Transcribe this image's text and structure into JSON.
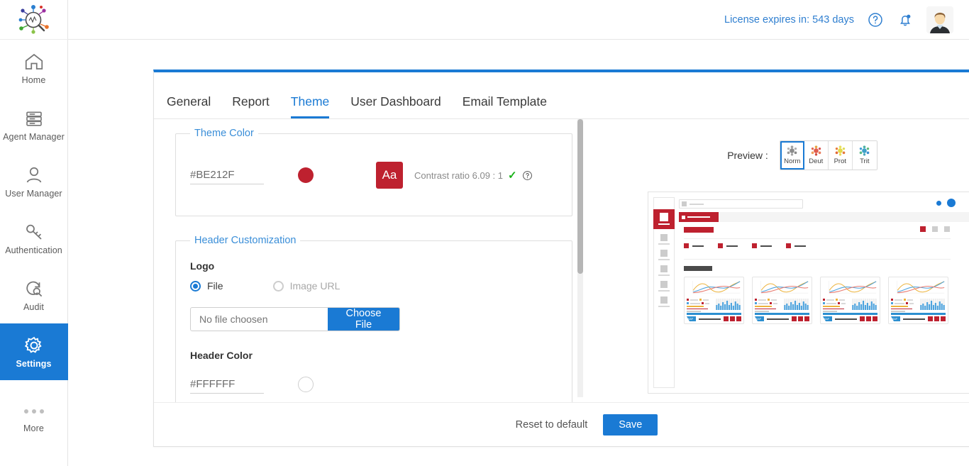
{
  "brand": {
    "logo_icon": "magnifier-analytics-logo",
    "accent_blue": "#1a7ad4"
  },
  "topbar": {
    "license_text": "License expires in: 543 days",
    "help_icon": "help-circle-icon",
    "notification_icon": "bell-icon",
    "avatar_icon": "user-avatar"
  },
  "sidebar": {
    "items": [
      {
        "label": "Home",
        "icon": "home-icon",
        "active": false
      },
      {
        "label": "Agent Manager",
        "icon": "server-icon",
        "active": false
      },
      {
        "label": "User Manager",
        "icon": "user-icon",
        "active": false
      },
      {
        "label": "Authentication",
        "icon": "key-icon",
        "active": false
      },
      {
        "label": "Audit",
        "icon": "audit-search-icon",
        "active": false
      },
      {
        "label": "Settings",
        "icon": "gear-icon",
        "active": true
      }
    ],
    "more_label": "More",
    "more_icon": "ellipsis-icon"
  },
  "tabs": [
    {
      "label": "General",
      "active": false
    },
    {
      "label": "Report",
      "active": false
    },
    {
      "label": "Theme",
      "active": true
    },
    {
      "label": "User Dashboard",
      "active": false
    },
    {
      "label": "Email Template",
      "active": false
    }
  ],
  "theme_color": {
    "legend": "Theme Color",
    "hex_value": "#BE212F",
    "swatch_color": "#BE212F",
    "sample_text": "Aa",
    "contrast_text": "Contrast ratio 6.09 : 1",
    "contrast_pass_icon": "check-icon",
    "help_icon": "help-circle-icon"
  },
  "header_customization": {
    "legend": "Header Customization",
    "logo_label": "Logo",
    "radio_file": "File",
    "radio_image_url": "Image URL",
    "file_placeholder": "No file choosen",
    "choose_file_label": "Choose File",
    "header_color_label": "Header Color",
    "header_color_hex": "#FFFFFF",
    "header_color_swatch": "#FFFFFF"
  },
  "preview": {
    "label": "Preview :",
    "options": [
      {
        "label": "Norm",
        "selected": true
      },
      {
        "label": "Deut",
        "selected": false
      },
      {
        "label": "Prot",
        "selected": false
      },
      {
        "label": "Trit",
        "selected": false
      }
    ],
    "mock_accent": "#BE212F",
    "mock_card_count": 4
  },
  "footer": {
    "reset_label": "Reset to default",
    "save_label": "Save"
  }
}
